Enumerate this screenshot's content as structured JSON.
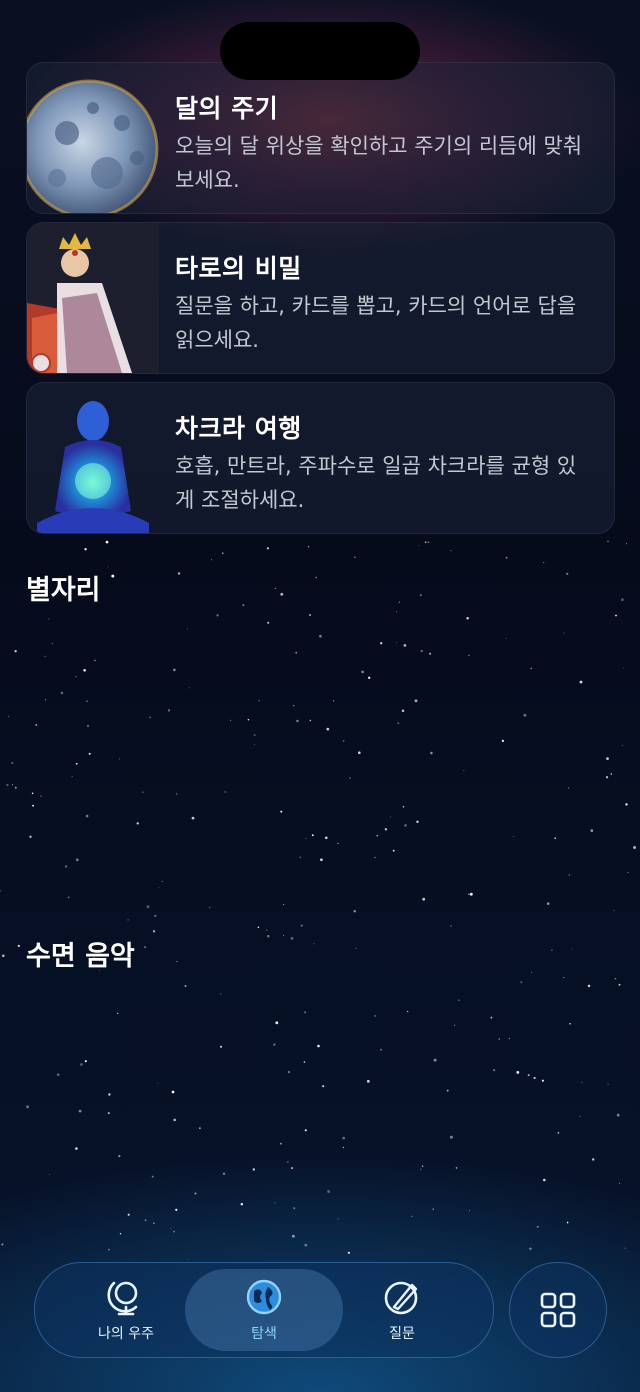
{
  "cards": [
    {
      "title": "달의 주기",
      "desc": "오늘의 달 위상을 확인하고 주기의 리듬에 맞춰보세요.",
      "image": "moon-image"
    },
    {
      "title": "타로의 비밀",
      "desc": "질문을 하고, 카드를 뽑고, 카드의 언어로 답을 읽으세요.",
      "image": "tarot-card-image"
    },
    {
      "title": "차크라 여행",
      "desc": "호흡, 만트라, 주파수로 일곱 차크라를 균형 있게 조절하세요.",
      "image": "chakra-figure-image"
    }
  ],
  "sections": {
    "constellations": "별자리",
    "sleep_music": "수면 음악"
  },
  "tabbar": {
    "tabs": [
      {
        "label": "나의 우주",
        "icon": "globe-stand-icon",
        "active": false
      },
      {
        "label": "탐색",
        "icon": "earth-icon",
        "active": true
      },
      {
        "label": "질문",
        "icon": "compass-pen-icon",
        "active": false
      }
    ],
    "grid_icon": "grid-icon"
  },
  "colors": {
    "accent": "#8fd3ff",
    "background": "#060b1c"
  }
}
